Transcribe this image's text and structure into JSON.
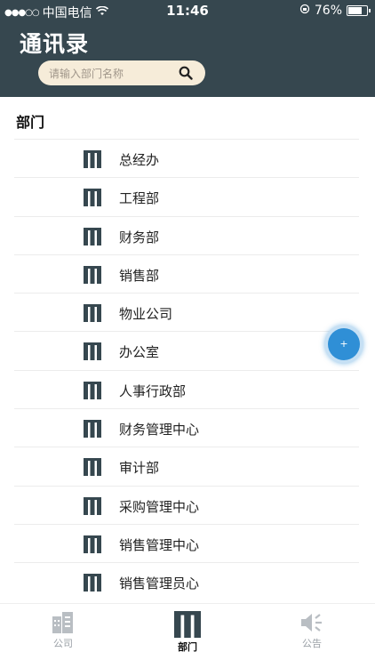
{
  "status_bar": {
    "carrier": "中国电信",
    "time": "11:46",
    "battery": "76%"
  },
  "header": {
    "title": "通讯录",
    "search_placeholder": "请输入部门名称"
  },
  "section_title": "部门",
  "departments": [
    "总经办",
    "工程部",
    "财务部",
    "销售部",
    "物业公司",
    "办公室",
    "人事行政部",
    "财务管理中心",
    "审计部",
    "采购管理中心",
    "销售管理中心",
    "销售管理员心"
  ],
  "tabs": {
    "company": "公司",
    "department": "部门",
    "announcement": "公告"
  },
  "colors": {
    "header_bg": "#36474f",
    "search_bg": "#f6ecd9",
    "icon_dark": "#36474f",
    "float_button": "#2f8fd6"
  }
}
